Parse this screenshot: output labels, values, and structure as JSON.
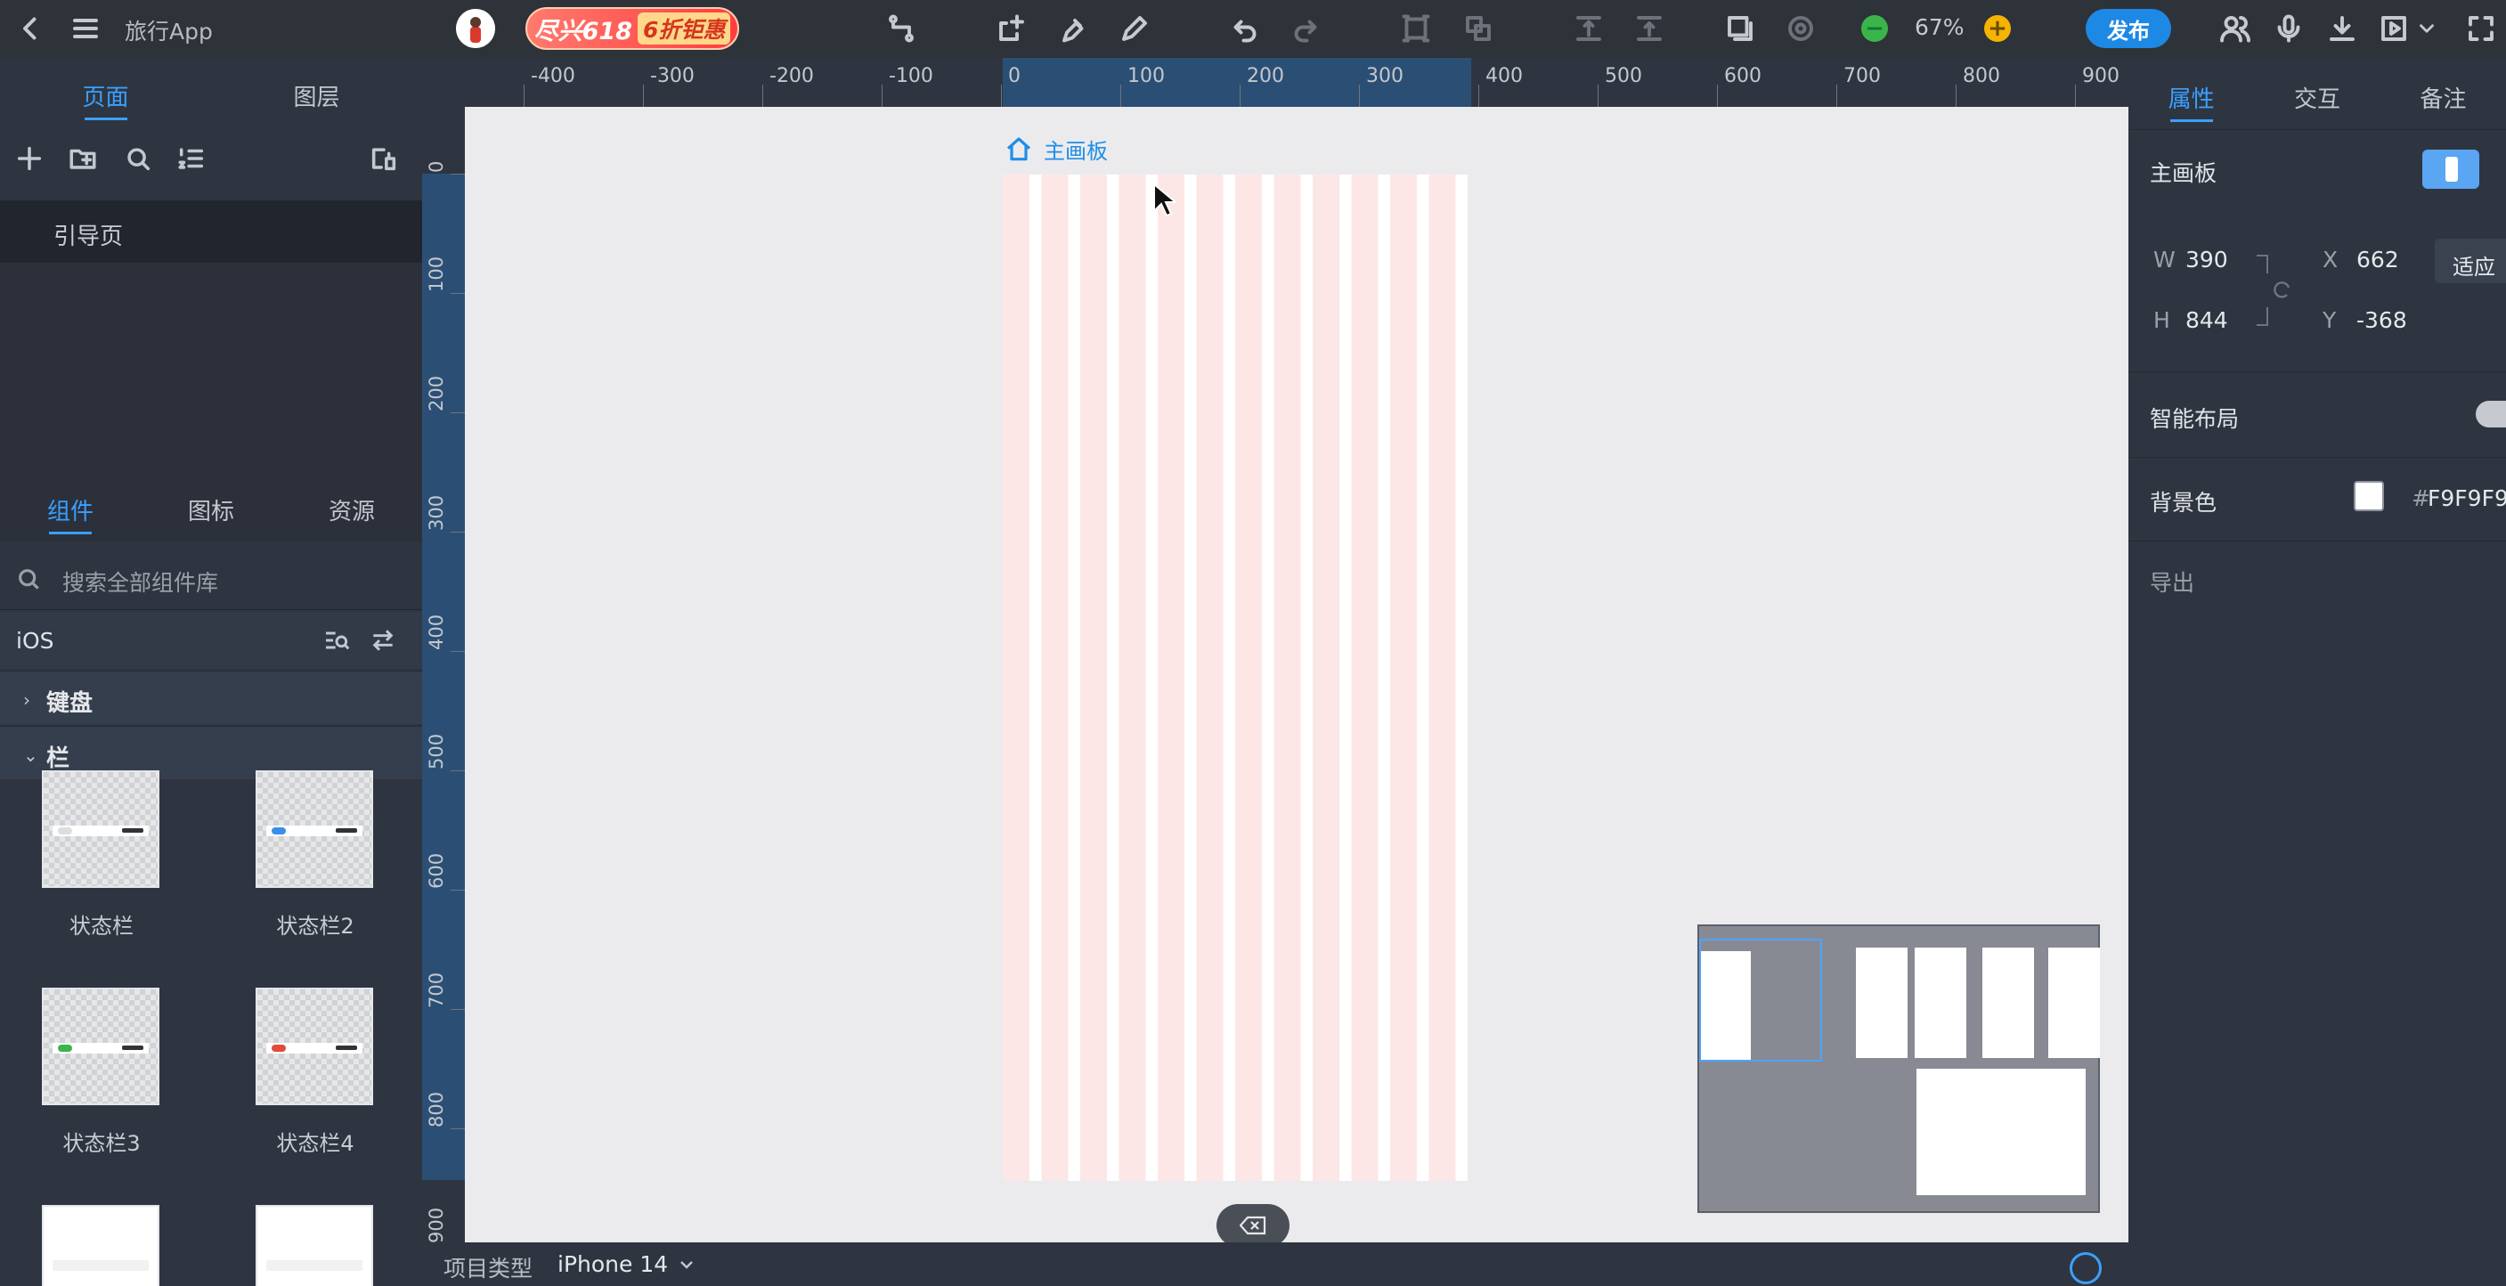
{
  "app": {
    "title": "旅行App"
  },
  "promo": {
    "text": "尽兴618",
    "tag": "6折钜惠"
  },
  "toolbar": {
    "zoom": "67%",
    "publish": "发布"
  },
  "left_panel": {
    "tabs": [
      "页面",
      "图层"
    ],
    "pages": [
      "引导页"
    ],
    "component_tabs": [
      "组件",
      "图标",
      "资源"
    ],
    "search_placeholder": "搜索全部组件库",
    "library": "iOS",
    "categories": [
      {
        "label": "键盘",
        "expanded": false
      },
      {
        "label": "栏",
        "expanded": true
      }
    ],
    "components": [
      {
        "label": "状态栏",
        "accent": "#ffffff"
      },
      {
        "label": "状态栏2",
        "accent": "#3a8fe8"
      },
      {
        "label": "状态栏3",
        "accent": "#3bb54a"
      },
      {
        "label": "状态栏4",
        "accent": "#e04b3c"
      }
    ]
  },
  "ruler": {
    "top_labels": [
      "-400",
      "-300",
      "-200",
      "-100",
      "0",
      "100",
      "200",
      "300",
      "400",
      "500",
      "600",
      "700",
      "800",
      "900"
    ],
    "left_labels": [
      "0",
      "100",
      "200",
      "300",
      "400",
      "500",
      "600",
      "700",
      "800",
      "900"
    ]
  },
  "canvas": {
    "artboard_label": "主画板",
    "grid_color": "#fde7e6"
  },
  "bottom_bar": {
    "project_type_label": "项目类型",
    "project_type_value": "iPhone 14"
  },
  "right_panel": {
    "tabs": [
      "属性",
      "交互",
      "备注"
    ],
    "section_title": "主画板",
    "fields": {
      "w_label": "W",
      "w_value": "390",
      "h_label": "H",
      "h_value": "844",
      "x_label": "X",
      "x_value": "662",
      "y_label": "Y",
      "y_value": "-368"
    },
    "fit_button": "适应",
    "smart_layout": "智能布局",
    "background_label": "背景色",
    "background_hash": "#",
    "background_value": "F9F9F9",
    "export": "导出"
  },
  "colors": {
    "accent": "#3aa0ff",
    "publish": "#1e88e5",
    "panel": "#2e3541"
  }
}
